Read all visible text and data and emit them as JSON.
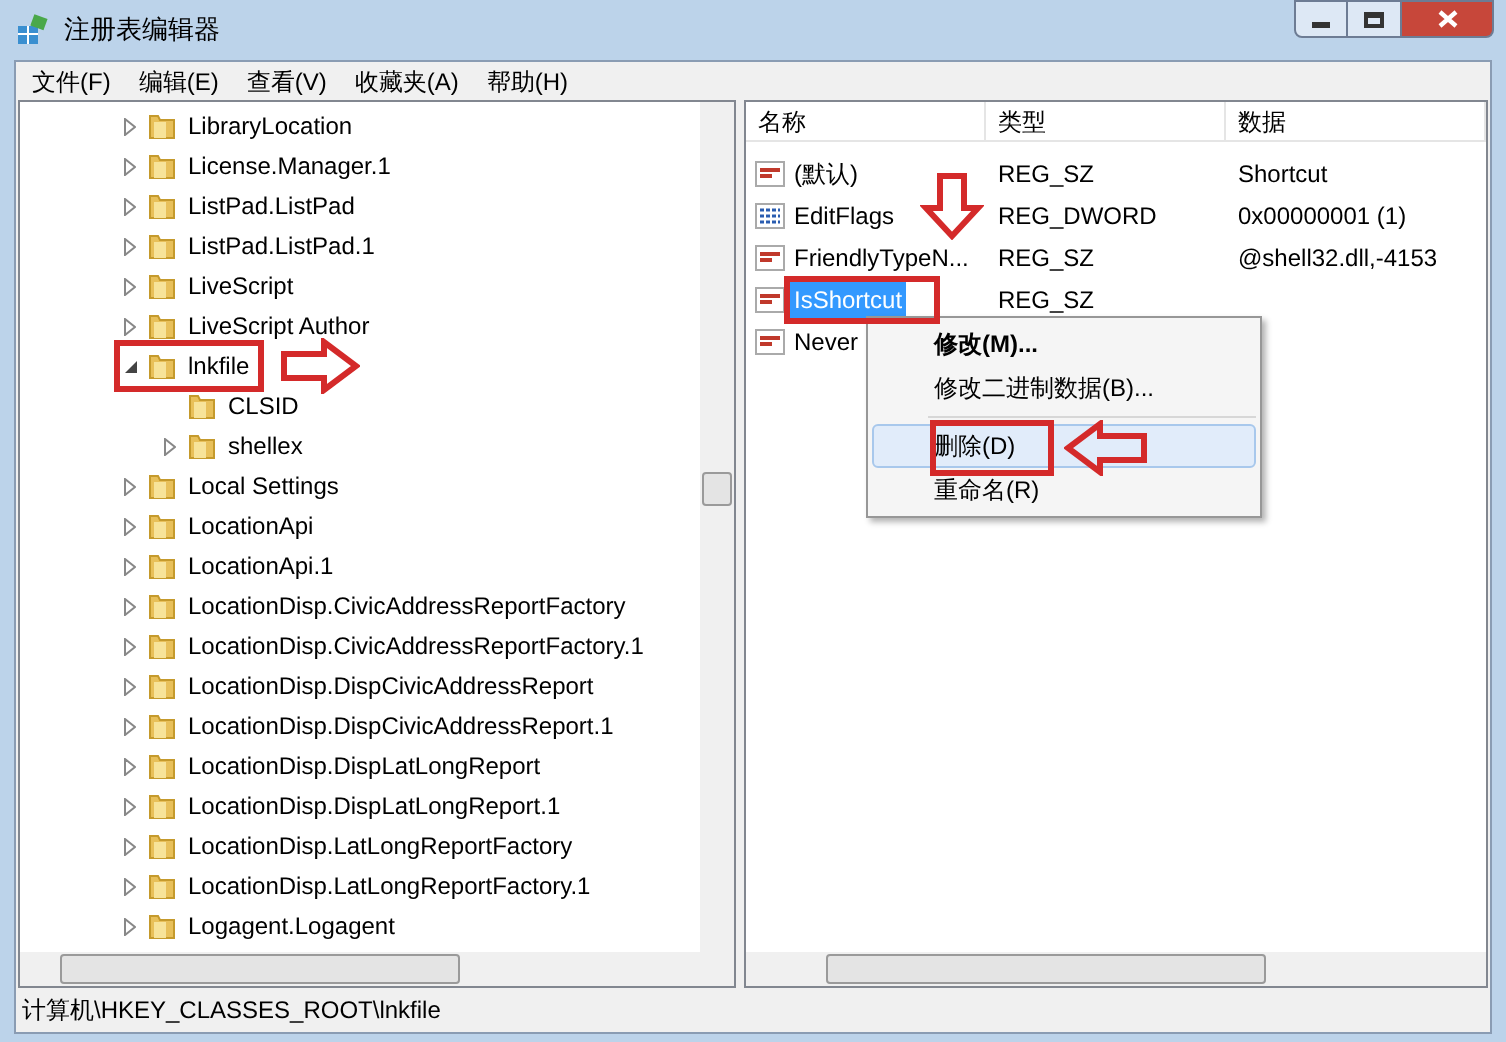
{
  "window": {
    "title": "注册表编辑器"
  },
  "menu_bar": [
    "文件(F)",
    "编辑(E)",
    "查看(V)",
    "收藏夹(A)",
    "帮助(H)"
  ],
  "tree": [
    {
      "label": "LibraryLocation",
      "expanded": false
    },
    {
      "label": "License.Manager.1",
      "expanded": false
    },
    {
      "label": "ListPad.ListPad",
      "expanded": false
    },
    {
      "label": "ListPad.ListPad.1",
      "expanded": false
    },
    {
      "label": "LiveScript",
      "expanded": false
    },
    {
      "label": "LiveScript Author",
      "expanded": false
    },
    {
      "label": "lnkfile",
      "expanded": true,
      "children": [
        {
          "label": "CLSID"
        },
        {
          "label": "shellex",
          "expanded": false
        }
      ]
    },
    {
      "label": "Local Settings",
      "expanded": false
    },
    {
      "label": "LocationApi",
      "expanded": false
    },
    {
      "label": "LocationApi.1",
      "expanded": false
    },
    {
      "label": "LocationDisp.CivicAddressReportFactory",
      "expanded": false
    },
    {
      "label": "LocationDisp.CivicAddressReportFactory.1",
      "expanded": false
    },
    {
      "label": "LocationDisp.DispCivicAddressReport",
      "expanded": false
    },
    {
      "label": "LocationDisp.DispCivicAddressReport.1",
      "expanded": false
    },
    {
      "label": "LocationDisp.DispLatLongReport",
      "expanded": false
    },
    {
      "label": "LocationDisp.DispLatLongReport.1",
      "expanded": false
    },
    {
      "label": "LocationDisp.LatLongReportFactory",
      "expanded": false
    },
    {
      "label": "LocationDisp.LatLongReportFactory.1",
      "expanded": false
    },
    {
      "label": "Logagent.Logagent",
      "expanded": false
    }
  ],
  "values": {
    "columns": [
      "名称",
      "类型",
      "数据"
    ],
    "rows": [
      {
        "kind": "string",
        "name": "(默认)",
        "type": "REG_SZ",
        "data": "Shortcut",
        "selected": false
      },
      {
        "kind": "dword",
        "name": "EditFlags",
        "type": "REG_DWORD",
        "data": "0x00000001 (1)",
        "selected": false
      },
      {
        "kind": "string",
        "name": "FriendlyTypeN...",
        "type": "REG_SZ",
        "data": "@shell32.dll,-4153",
        "selected": false
      },
      {
        "kind": "string",
        "name": "IsShortcut",
        "type": "REG_SZ",
        "selected": true
      },
      {
        "kind": "string",
        "name": "Never",
        "selected": false
      }
    ]
  },
  "context_menu": [
    {
      "kind": "item",
      "label": "修改(M)...",
      "default": true,
      "selected": false
    },
    {
      "kind": "item",
      "label": "修改二进制数据(B)...",
      "default": false,
      "selected": false
    },
    {
      "kind": "separator"
    },
    {
      "kind": "item",
      "label": "删除(D)",
      "default": false,
      "selected": true
    },
    {
      "kind": "item",
      "label": "重命名(R)",
      "default": false,
      "selected": false
    }
  ],
  "status_bar": "计算机\\HKEY_CLASSES_ROOT\\lnkfile"
}
